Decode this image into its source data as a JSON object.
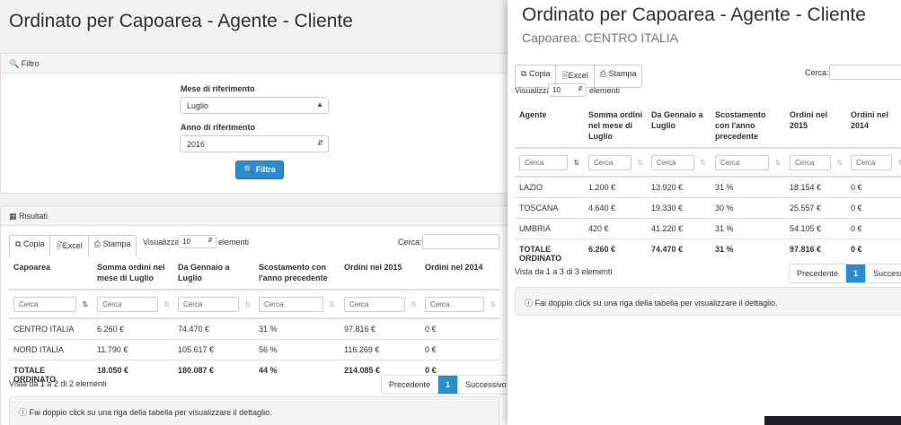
{
  "base": {
    "title": "Ordinato per Capoarea - Agente - Cliente",
    "filter_panel": {
      "heading": "Filtro",
      "month_label": "Mese di riferimento",
      "month_value": "Luglio",
      "year_label": "Anno di riferimento",
      "year_value": "2016",
      "submit_label": "Filtra"
    },
    "results_panel": {
      "heading": "Risultati",
      "copy_label": "Copia",
      "excel_label": "Excel",
      "print_label": "Stampa",
      "show_label": "Visualizza",
      "page_size": "10",
      "elements_label": "elementi",
      "search_label": "Cerca:",
      "filter_placeholder": "Cerca",
      "columns": [
        "Capoarea",
        "Somma ordini nel mese di Luglio",
        "Da Gennaio a Luglio",
        "Scostamento con l'anno precedente",
        "Ordini nel 2015",
        "Ordini nel 2014"
      ],
      "rows": [
        [
          "CENTRO ITALIA",
          "6.260 €",
          "74.470 €",
          "31 %",
          "97.816 €",
          "0 €"
        ],
        [
          "NORD ITALIA",
          "11.790 €",
          "105.617 €",
          "56 %",
          "116.269 €",
          "0 €"
        ]
      ],
      "total": [
        "TOTALE ORDINATO",
        "18.050 €",
        "180.087 €",
        "44 %",
        "214.085 €",
        "0 €"
      ],
      "info": "Vista da 1 a 2 di 2 elementi",
      "prev_label": "Precedente",
      "page": "1",
      "next_label": "Successivo",
      "hint": "Fai doppio click su una riga della tabella per visualizzare il dettaglio."
    }
  },
  "popup": {
    "title": "Ordinato per Capoarea - Agente - Cliente",
    "subtitle": "Capoarea: CENTRO ITALIA",
    "copy_label": "Copia",
    "excel_label": "Excel",
    "print_label": "Stampa",
    "show_label": "Visualizza",
    "page_size": "10",
    "elements_label": "elementi",
    "search_label": "Cerca:",
    "filter_placeholder": "Cerca",
    "columns": [
      "Agente",
      "Somma ordini nel mese di Luglio",
      "Da Gennaio a Luglio",
      "Scostamento con l'anno precedente",
      "Ordini nel 2015",
      "Ordini nel 2014"
    ],
    "rows": [
      [
        "LAZIO",
        "1.200 €",
        "13.920 €",
        "31 %",
        "18.154 €",
        "0 €"
      ],
      [
        "TOSCANA",
        "4.640 €",
        "19.330 €",
        "30 %",
        "25.557 €",
        "0 €"
      ],
      [
        "UMBRIA",
        "420 €",
        "41.220 €",
        "31 %",
        "54.105 €",
        "0 €"
      ]
    ],
    "total": [
      "TOTALE ORDINATO",
      "6.260 €",
      "74.470 €",
      "31 %",
      "97.816 €",
      "0 €"
    ],
    "info": "Vista da 1 a 3 di 3 elementi",
    "prev_label": "Precedente",
    "page": "1",
    "next_label": "Successivo",
    "hint": "Fai doppio click su una riga della tabella per visualizzare il dettaglio."
  },
  "colors": {
    "primary": "#2a8bd0",
    "panel_header": "#f5f5f5"
  }
}
